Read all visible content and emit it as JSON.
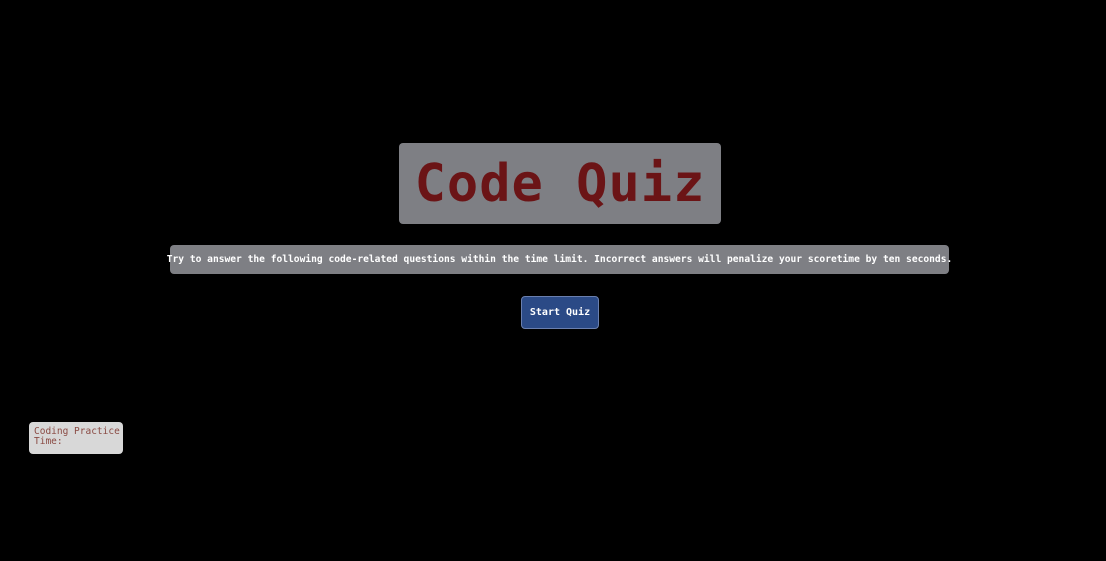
{
  "header": {
    "title": "Code Quiz"
  },
  "intro": {
    "description": "Try to answer the following code-related questions within the time limit. Incorrect answers will penalize your scoretime by ten seconds."
  },
  "actions": {
    "start_label": "Start Quiz"
  },
  "footer": {
    "practice_label": "Coding Practice",
    "time_label": "Time:"
  },
  "colors": {
    "background": "#000000",
    "panel": "#7e7f84",
    "title_text": "#6b1416",
    "button": "#2b4a86",
    "info_panel": "#d8d8d8",
    "info_text": "#8a4a43"
  }
}
